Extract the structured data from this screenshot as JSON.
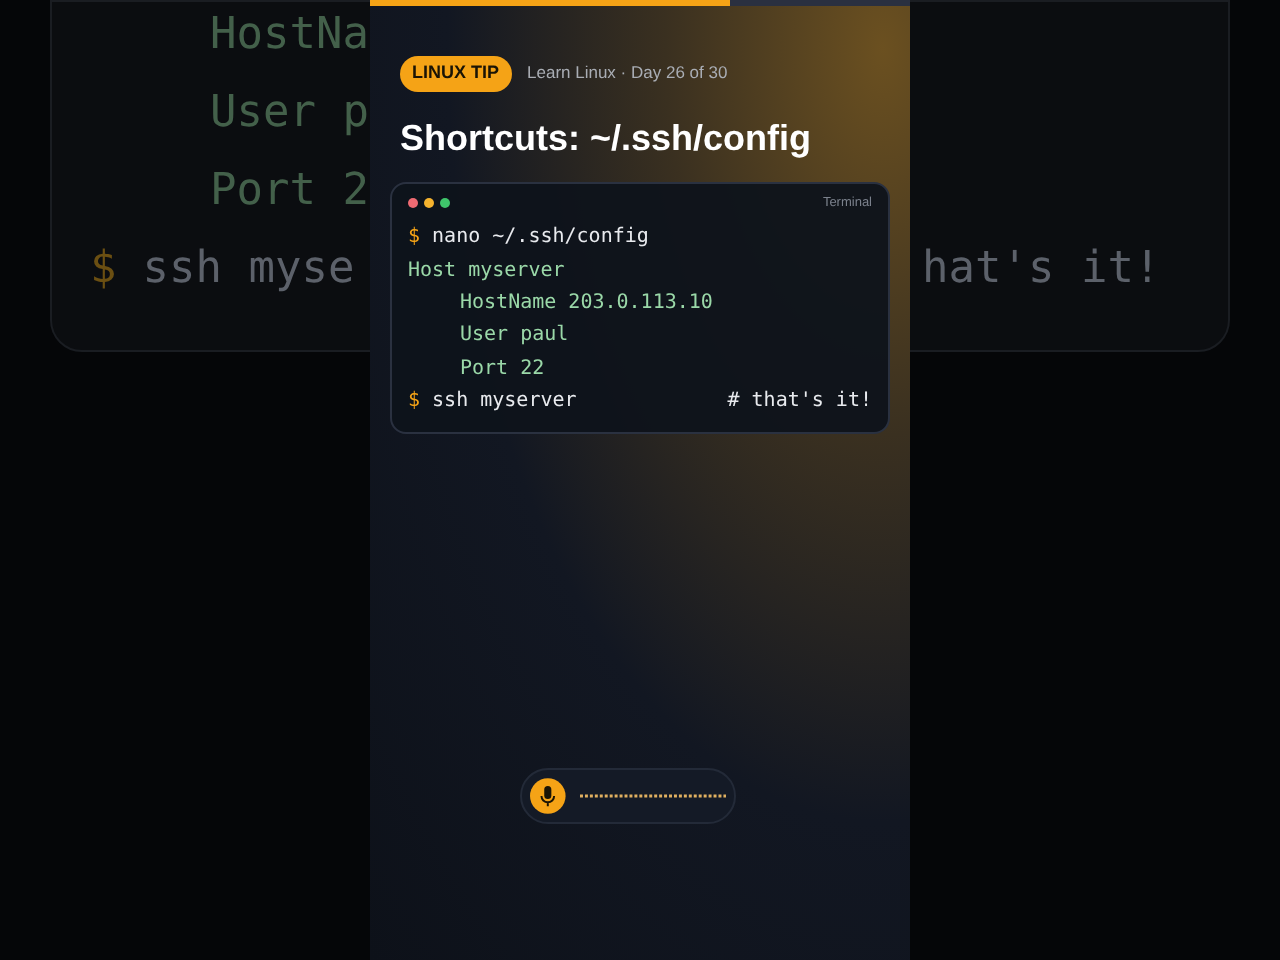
{
  "background_terminal": {
    "left_lines": [
      {
        "kind": "config",
        "text": "HostNa"
      },
      {
        "kind": "config",
        "text": "User p"
      },
      {
        "kind": "config",
        "text": "Port 2"
      },
      {
        "kind": "command",
        "prompt": "$",
        "text": "ssh myse"
      }
    ],
    "right_lines": [
      {
        "kind": "comment",
        "text": "hat's it!"
      }
    ]
  },
  "progress": {
    "level": 0.667
  },
  "badge": "LINUX TIP",
  "series": "Learn Linux · Day 26 of 30",
  "title": "Shortcuts: ~/.ssh/config",
  "terminal": {
    "label": "Terminal",
    "lines": [
      {
        "kind": "command",
        "prompt": "$",
        "text": "nano ~/.ssh/config"
      },
      {
        "kind": "config",
        "text": "Host myserver",
        "children": [
          {
            "kind": "config",
            "text": "HostName 203.0.113.10"
          },
          {
            "kind": "config",
            "text": "User paul"
          },
          {
            "kind": "config",
            "text": "Port 22"
          }
        ]
      },
      {
        "kind": "command",
        "prompt": "$",
        "text": "ssh myserver",
        "comment": "# that's it!"
      }
    ]
  }
}
